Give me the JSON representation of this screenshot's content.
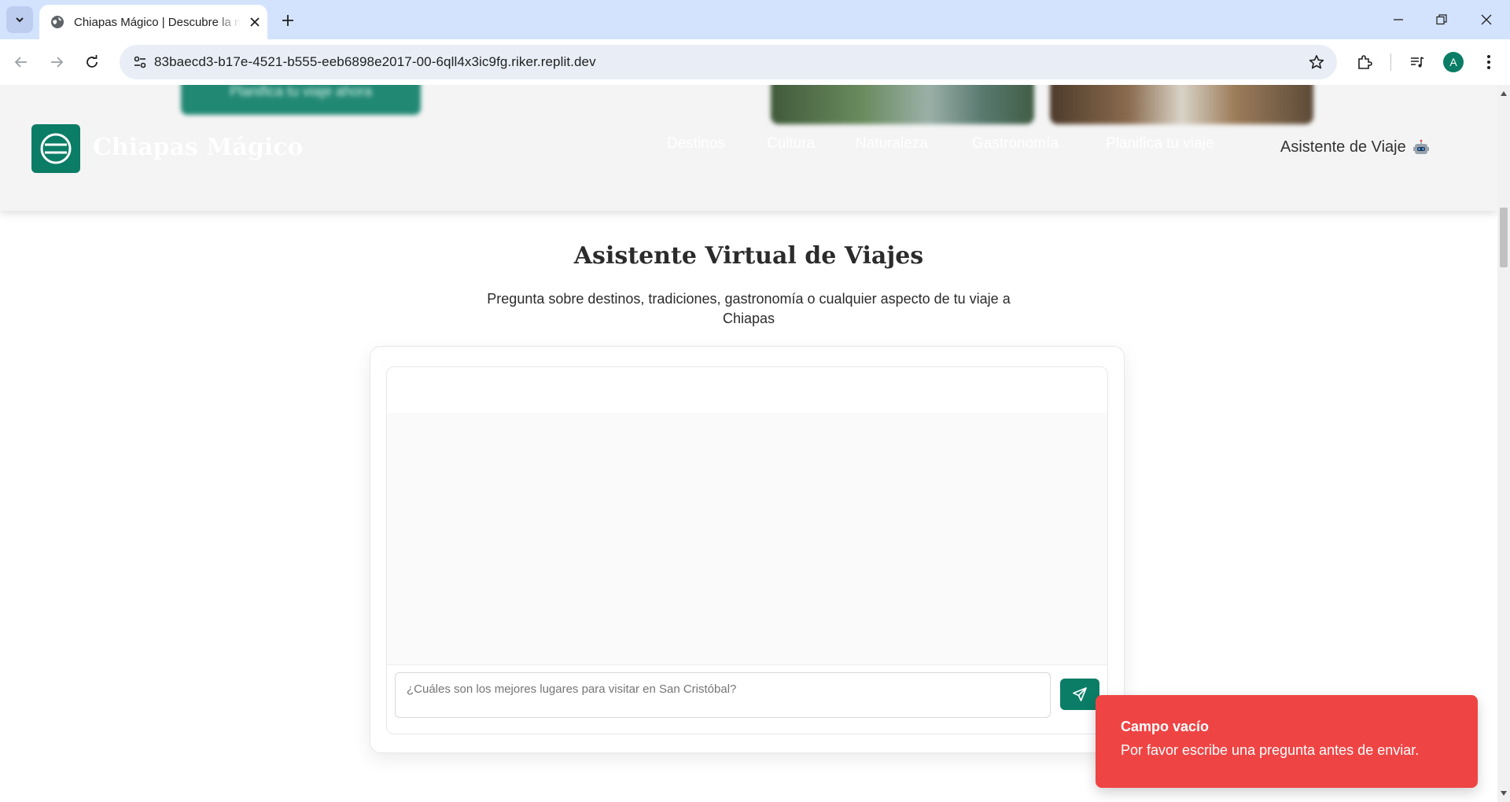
{
  "browser": {
    "tab_title": "Chiapas Mágico | Descubre la magia de Chiapas",
    "url": "83baecd3-b17e-4521-b555-eeb6898e2017-00-6qll4x3ic9fg.riker.replit.dev",
    "profile_initial": "A"
  },
  "header": {
    "hero_cta": "Planifica tu viaje ahora",
    "brand": "Chiapas Mágico",
    "nav": [
      "Destinos",
      "Cultura",
      "Naturaleza",
      "Gastronomía",
      "Planifica tu viaje"
    ],
    "assistant_link": "Asistente de Viaje"
  },
  "assistant_section": {
    "title": "Asistente Virtual de Viajes",
    "subtitle": "Pregunta sobre destinos, tradiciones, gastronomía o cualquier aspecto de tu viaje a Chiapas",
    "input_placeholder": "¿Cuáles son los mejores lugares para visitar en San Cristóbal?"
  },
  "toast": {
    "title": "Campo vacío",
    "description": "Por favor escribe una pregunta antes de enviar."
  },
  "colors": {
    "brand": "#0b7d66",
    "toast": "#ef4444",
    "tabbar": "#d3e3fd"
  },
  "icons": [
    "tab-list-icon",
    "globe-icon",
    "close-icon",
    "plus-icon",
    "minimize-icon",
    "restore-icon",
    "back-icon",
    "forward-icon",
    "reload-icon",
    "site-info-icon",
    "star-icon",
    "extensions-icon",
    "media-icon",
    "more-icon",
    "robot-icon",
    "send-icon"
  ]
}
